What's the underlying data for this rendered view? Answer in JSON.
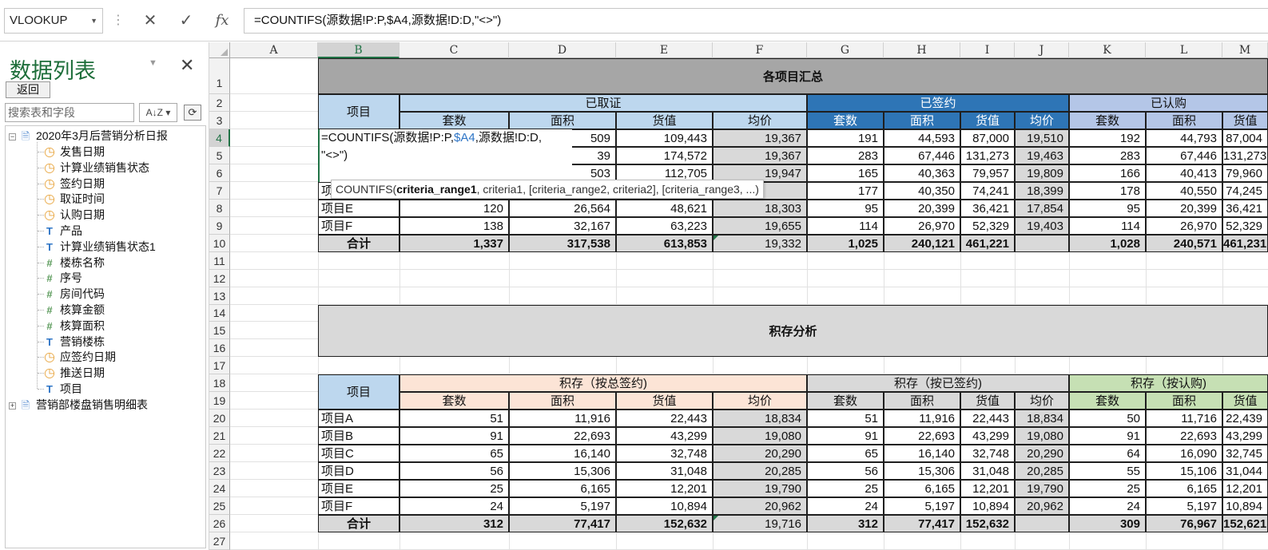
{
  "formula_bar": {
    "name_box": "VLOOKUP",
    "cancel_icon": "✕",
    "enter_icon": "✓",
    "fx_label": "fx",
    "formula": "=COUNTIFS(源数据!P:P,$A4,源数据!D:D,\"<>\")"
  },
  "field_pane": {
    "title": "数据列表",
    "back_label": "返回",
    "search_placeholder": "搜索表和字段",
    "sort_label": "A↓Z",
    "tree_root": "2020年3月后营销分析日报",
    "fields": [
      {
        "type": "date",
        "label": "发售日期"
      },
      {
        "type": "date",
        "label": "计算业绩销售状态"
      },
      {
        "type": "date",
        "label": "签约日期"
      },
      {
        "type": "date",
        "label": "取证时间"
      },
      {
        "type": "date",
        "label": "认购日期"
      },
      {
        "type": "text",
        "label": "产品"
      },
      {
        "type": "text",
        "label": "计算业绩销售状态1"
      },
      {
        "type": "number",
        "label": "楼栋名称"
      },
      {
        "type": "number",
        "label": "序号"
      },
      {
        "type": "number",
        "label": "房间代码"
      },
      {
        "type": "number",
        "label": "核算金额"
      },
      {
        "type": "number",
        "label": "核算面积"
      },
      {
        "type": "text",
        "label": "营销楼栋"
      },
      {
        "type": "date",
        "label": "应签约日期"
      },
      {
        "type": "date",
        "label": "推送日期"
      },
      {
        "type": "text",
        "label": "项目"
      }
    ],
    "tree_root2": "营销部楼盘销售明细表"
  },
  "sheet": {
    "col_letters": [
      "A",
      "B",
      "C",
      "D",
      "E",
      "F",
      "G",
      "H",
      "I",
      "J",
      "K",
      "L",
      "M"
    ],
    "row_numbers": [
      "1",
      "2",
      "3",
      "4",
      "5",
      "6",
      "7",
      "8",
      "9",
      "10",
      "11",
      "12",
      "13",
      "14",
      "15",
      "16",
      "17",
      "18",
      "19",
      "20",
      "21",
      "22",
      "23",
      "24",
      "25",
      "26",
      "27"
    ],
    "title1": "各项目汇总",
    "title2": "积存分析",
    "header_project": "项目",
    "group1": {
      "a": "已取证",
      "b": "已签约",
      "c": "已认购"
    },
    "group2": {
      "a": "积存（按总签约)",
      "b": "积存（按已签约)",
      "c": "积存（按认购)"
    },
    "sub_headers": [
      "套数",
      "面积",
      "货值",
      "均价",
      "套数",
      "面积",
      "货值",
      "均价",
      "套数",
      "面积",
      "货值"
    ],
    "table1_rows": [
      [
        "",
        "",
        "509",
        "109,443",
        "19,367",
        "191",
        "44,593",
        "87,000",
        "19,510",
        "192",
        "44,793",
        "87,004"
      ],
      [
        "",
        "",
        "39",
        "174,572",
        "19,367",
        "283",
        "67,446",
        "131,273",
        "19,463",
        "283",
        "67,446",
        "131,273"
      ],
      [
        "",
        "",
        "503",
        "112,705",
        "19,947",
        "165",
        "40,363",
        "79,957",
        "19,809",
        "166",
        "40,413",
        "79,960"
      ],
      [
        "项",
        "",
        "",
        "",
        "",
        "177",
        "40,350",
        "74,241",
        "18,399",
        "178",
        "40,550",
        "74,245"
      ],
      [
        "项目E",
        "120",
        "26,564",
        "48,621",
        "18,303",
        "95",
        "20,399",
        "36,421",
        "17,854",
        "95",
        "20,399",
        "36,421"
      ],
      [
        "项目F",
        "138",
        "32,167",
        "63,223",
        "19,655",
        "114",
        "26,970",
        "52,329",
        "19,403",
        "114",
        "26,970",
        "52,329"
      ]
    ],
    "table1_total": [
      "合计",
      "1,337",
      "317,538",
      "613,853",
      "19,332",
      "1,025",
      "240,121",
      "461,221",
      "",
      "1,028",
      "240,571",
      "461,231"
    ],
    "table2_rows": [
      [
        "项目A",
        "51",
        "11,916",
        "22,443",
        "18,834",
        "51",
        "11,916",
        "22,443",
        "18,834",
        "50",
        "11,716",
        "22,439"
      ],
      [
        "项目B",
        "91",
        "22,693",
        "43,299",
        "19,080",
        "91",
        "22,693",
        "43,299",
        "19,080",
        "91",
        "22,693",
        "43,299"
      ],
      [
        "项目C",
        "65",
        "16,140",
        "32,748",
        "20,290",
        "65",
        "16,140",
        "32,748",
        "20,290",
        "64",
        "16,090",
        "32,745"
      ],
      [
        "项目D",
        "56",
        "15,306",
        "31,048",
        "20,285",
        "56",
        "15,306",
        "31,048",
        "20,285",
        "55",
        "15,106",
        "31,044"
      ],
      [
        "项目E",
        "25",
        "6,165",
        "12,201",
        "19,790",
        "25",
        "6,165",
        "12,201",
        "19,790",
        "25",
        "6,165",
        "12,201"
      ],
      [
        "项目F",
        "24",
        "5,197",
        "10,894",
        "20,962",
        "24",
        "5,197",
        "10,894",
        "20,962",
        "24",
        "5,197",
        "10,894"
      ]
    ],
    "table2_total": [
      "合计",
      "312",
      "77,417",
      "152,632",
      "19,716",
      "312",
      "77,417",
      "152,632",
      "",
      "309",
      "76,967",
      "152,621"
    ],
    "edit_line1_a": "=COUNTIFS(源数据!P:P,",
    "edit_line1_b": "$A4",
    "edit_line1_c": ",源数据!D:D,",
    "edit_line2": "\"<>\")",
    "tooltip_fn": "COUNTIFS(",
    "tooltip_bold": "criteria_range1",
    "tooltip_rest": ", criteria1, [criteria_range2, criteria2], [criteria_range3, ...)"
  },
  "colors": {
    "title_bg": "#a6a6a6",
    "light_blue": "#bdd7ee",
    "dark_blue": "#2e75b6",
    "lavender": "#b4c6e7",
    "peach": "#fce4d6",
    "gray_hdr": "#d9d9d9",
    "green_hdr": "#c6e0b4",
    "total_bg": "#d9d9d9",
    "avg_bg": "#d9d9d9",
    "excel_green": "#217346"
  }
}
